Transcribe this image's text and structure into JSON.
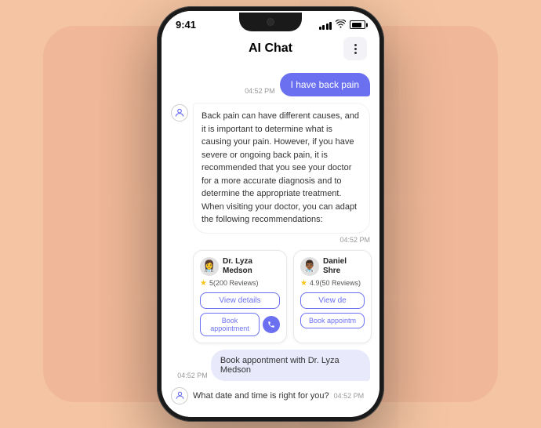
{
  "phone": {
    "status_bar": {
      "time": "9:41",
      "signal": "signal",
      "wifi": "wifi",
      "battery": "battery"
    },
    "header": {
      "title": "AI Chat",
      "menu_label": "menu"
    }
  },
  "chat": {
    "user_message": {
      "text": "I have back pain",
      "time": "04:52 PM"
    },
    "ai_response": {
      "text": "Back pain can have different causes, and it is important to determine what is causing your pain. However, if you have severe or ongoing back pain, it is recommended that you see your doctor for a more accurate diagnosis and to determine the appropriate treatment. When visiting your doctor, you can adapt the following recommendations:",
      "time": "04:52 PM"
    },
    "doctors": [
      {
        "name": "Dr. Lyza Medson",
        "rating": "5",
        "reviews": "(200 Reviews)",
        "view_details": "View details",
        "book_appointment": "Book appointment",
        "avatar": "👩‍⚕️"
      },
      {
        "name": "Daniel Shre",
        "rating": "4.9",
        "reviews": "(50 Reviews)",
        "view_details": "View de",
        "book_appointment": "Book appointm",
        "avatar": "👨🏾‍⚕️"
      }
    ],
    "booking_confirm": {
      "text": "Book appontment with Dr. Lyza Medson",
      "time": "04:52 PM"
    },
    "question": {
      "text": "What date and time is right for you?",
      "time": "04:52 PM"
    }
  },
  "colors": {
    "accent": "#6b70f0",
    "user_bubble": "#6b70f0",
    "booking_bubble": "#e8e9fb",
    "star": "#f5c518"
  }
}
